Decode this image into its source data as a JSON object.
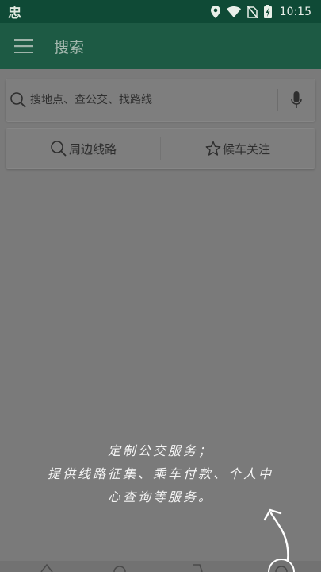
{
  "status_bar": {
    "app_glyph": "忠",
    "time": "10:15",
    "icons": [
      "location-icon",
      "wifi-icon",
      "no-sim-icon",
      "battery-charging-icon"
    ]
  },
  "app_bar": {
    "title": "搜索",
    "menu_icon": "menu-icon"
  },
  "search": {
    "placeholder": "搜地点、查公交、找路线",
    "search_icon": "search-icon",
    "mic_icon": "microphone-icon"
  },
  "actions": {
    "nearby_routes": "周边线路",
    "waiting_follow": "候车关注"
  },
  "overlay": {
    "line1": "定制公交服务；",
    "line2": "提供线路征集、乘车付款、个人中",
    "line3": "心查询等服务。"
  },
  "colors": {
    "status_bar": "#0f4a36",
    "app_bar": "#1d5a44",
    "scrim": "#7a7a7a"
  }
}
